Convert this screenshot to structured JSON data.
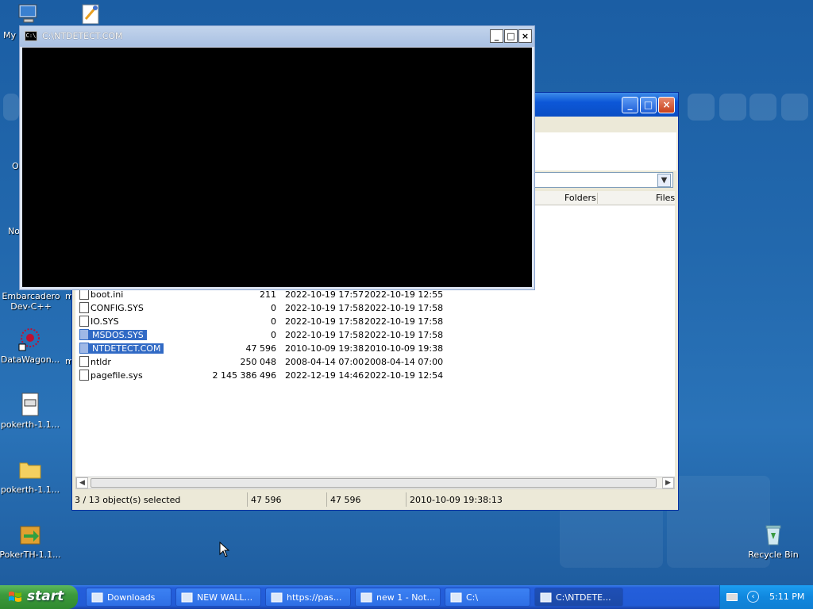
{
  "desktop": {
    "icons": [
      {
        "label": "My",
        "icon": "computer-icon"
      },
      {
        "label": "Embarcadero Dev-C++",
        "icon": "devcpp-icon"
      },
      {
        "label": "DataWagon...",
        "icon": "datawagon-icon"
      },
      {
        "label": "pokerth-1.1...",
        "icon": "file-icon"
      },
      {
        "label": "pokerth-1.1...",
        "icon": "folder-icon"
      },
      {
        "label": "PokerTH-1.1...",
        "icon": "installer-icon"
      },
      {
        "label": "Recycle Bin",
        "icon": "recycle-bin-icon"
      }
    ],
    "partial_labels": [
      "O",
      "No",
      "m",
      "m"
    ]
  },
  "cmd_window": {
    "title": "C:\\NTDETECT.COM",
    "icon_text": "C:\\",
    "minimize": "_",
    "maximize": "□",
    "close": "×"
  },
  "explorer_window": {
    "columns": {
      "folders": "Folders",
      "files": "Files"
    },
    "files": [
      {
        "name": "boot.ini",
        "size": "211",
        "modified": "2022-10-19 17:57",
        "created": "2022-10-19 12:55",
        "selected": false
      },
      {
        "name": "CONFIG.SYS",
        "size": "0",
        "modified": "2022-10-19 17:58",
        "created": "2022-10-19 17:58",
        "selected": false
      },
      {
        "name": "IO.SYS",
        "size": "0",
        "modified": "2022-10-19 17:58",
        "created": "2022-10-19 17:58",
        "selected": false
      },
      {
        "name": "MSDOS.SYS",
        "size": "0",
        "modified": "2022-10-19 17:58",
        "created": "2022-10-19 17:58",
        "selected": true
      },
      {
        "name": "NTDETECT.COM",
        "size": "47 596",
        "modified": "2010-10-09 19:38",
        "created": "2010-10-09 19:38",
        "selected": true
      },
      {
        "name": "ntldr",
        "size": "250 048",
        "modified": "2008-04-14 07:00",
        "created": "2008-04-14 07:00",
        "selected": false
      },
      {
        "name": "pagefile.sys",
        "size": "2 145 386 496",
        "modified": "2022-12-19 14:46",
        "created": "2022-10-19 12:54",
        "selected": false
      }
    ],
    "status": {
      "selection": "3 / 13 object(s) selected",
      "size": "47 596",
      "packed": "47 596",
      "date": "2010-10-09 19:38:13"
    }
  },
  "taskbar": {
    "start_label": "start",
    "tasks": [
      {
        "label": "Downloads",
        "icon": "folder-icon",
        "active": false
      },
      {
        "label": "NEW WALL...",
        "icon": "wall-icon",
        "active": false
      },
      {
        "label": "https://pas...",
        "icon": "chrome-icon",
        "active": false
      },
      {
        "label": "new 1 - Not...",
        "icon": "notepad-icon",
        "active": false
      },
      {
        "label": "C:\\",
        "icon": "7zip-icon",
        "active": false
      },
      {
        "label": "C:\\NTDETE...",
        "icon": "cmd-icon",
        "active": true
      }
    ],
    "clock": "5:11 PM"
  },
  "colors": {
    "selection": "#316ac5",
    "desktop": "#2268ad",
    "taskbar": "#245edb",
    "start": "#3c9a3c"
  }
}
